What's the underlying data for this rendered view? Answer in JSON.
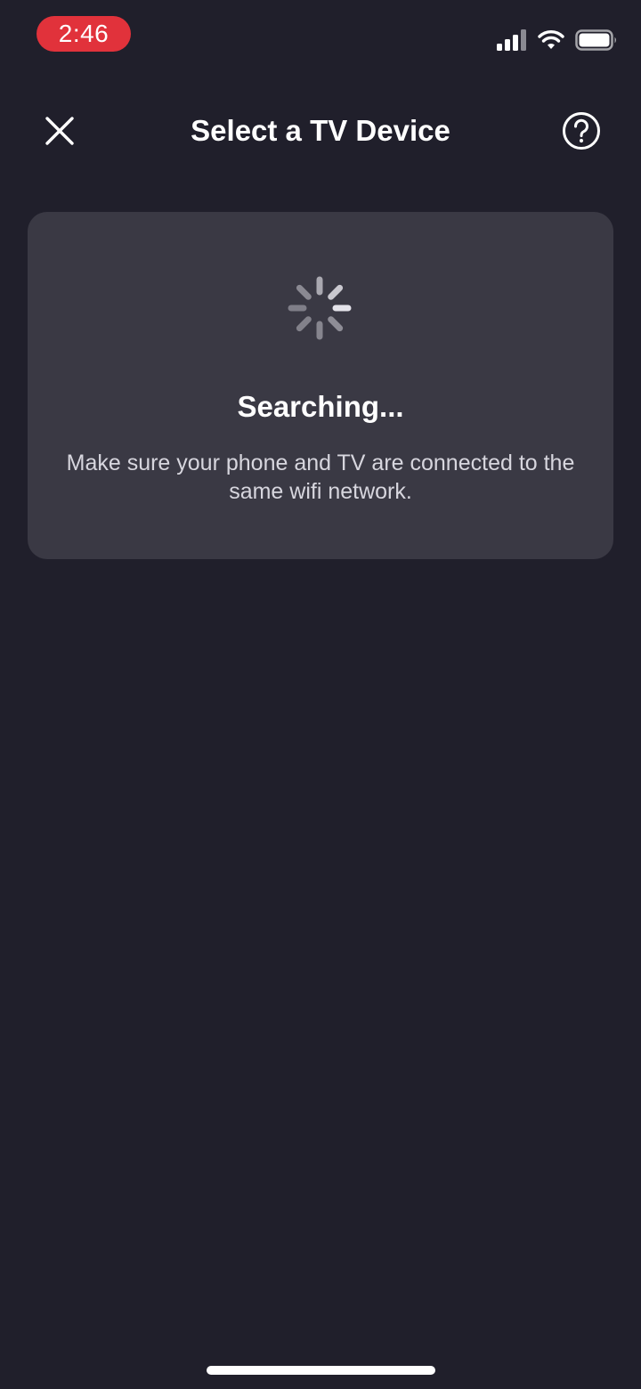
{
  "status_bar": {
    "time": "2:46",
    "time_pill_color": "#e1323b",
    "icons": [
      "signal-icon",
      "wifi-icon",
      "battery-icon"
    ]
  },
  "header": {
    "title": "Select a TV Device",
    "close_icon": "close-icon",
    "help_icon": "help-icon"
  },
  "search_card": {
    "spinner_icon": "loading-spinner-icon",
    "title": "Searching...",
    "message": "Make sure your phone and TV are connected to the same wifi network."
  },
  "colors": {
    "background": "#201f2b",
    "card": "#3a3944",
    "text_primary": "#ffffff",
    "text_secondary": "#d7d6de"
  }
}
